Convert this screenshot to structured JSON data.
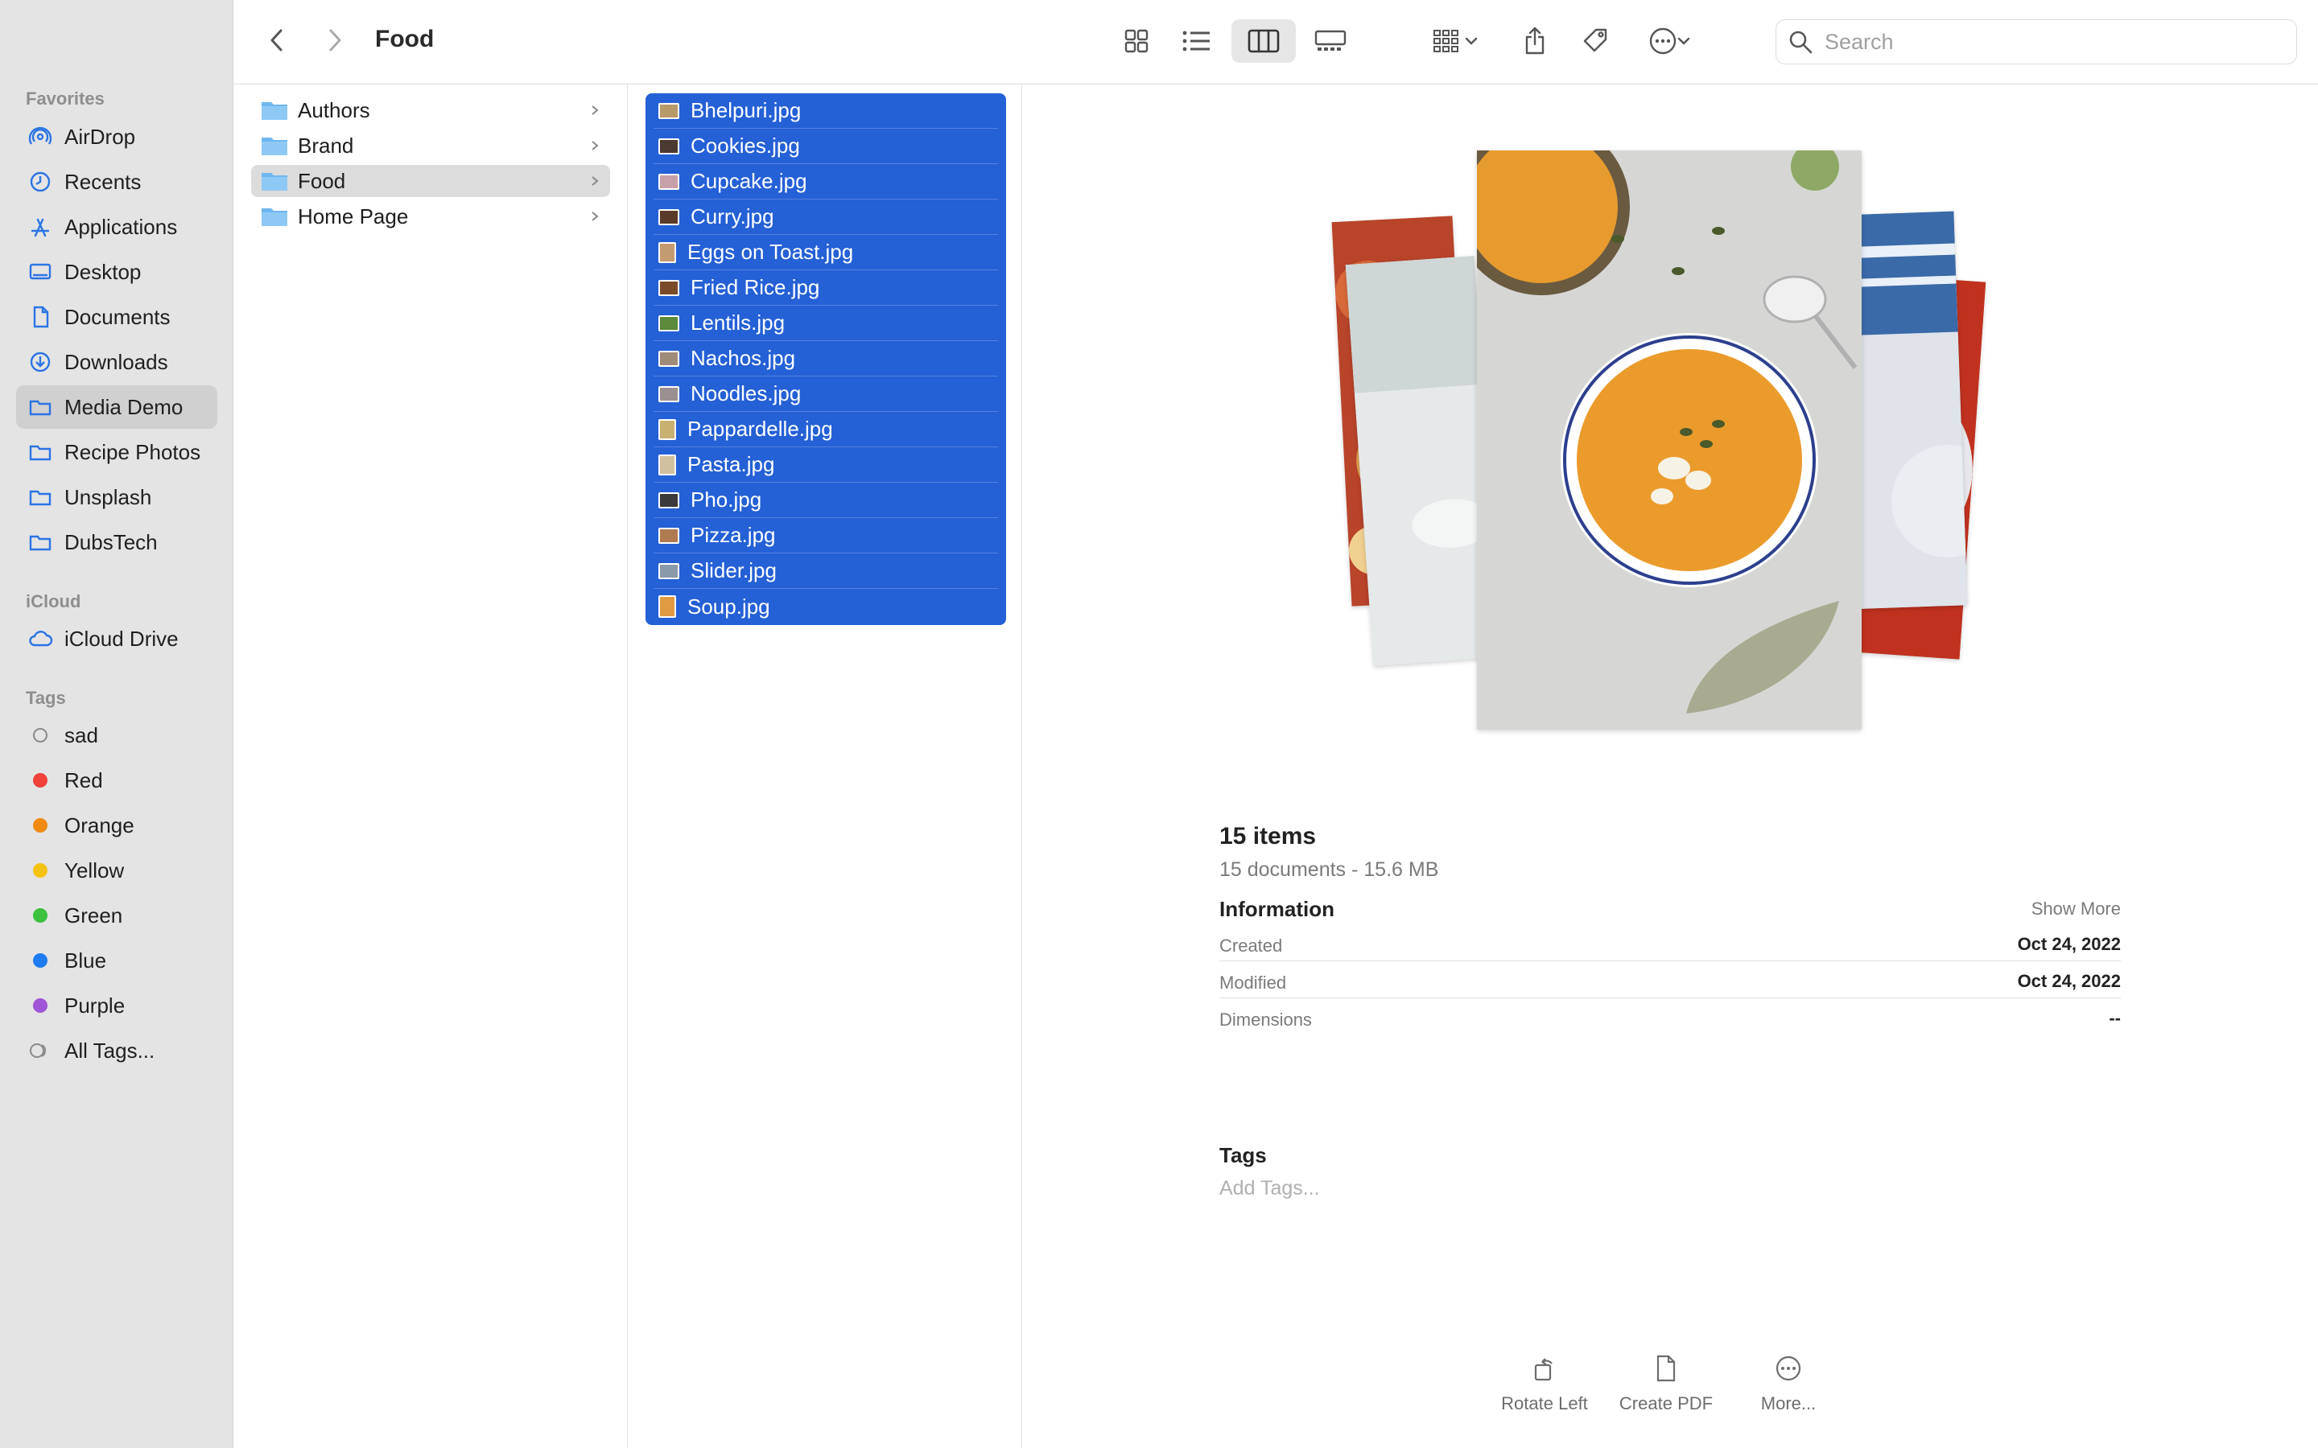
{
  "window": {
    "title": "Food"
  },
  "sidebar": {
    "favorites_title": "Favorites",
    "favorites": [
      {
        "label": "AirDrop",
        "icon": "airdrop-icon"
      },
      {
        "label": "Recents",
        "icon": "clock-icon"
      },
      {
        "label": "Applications",
        "icon": "applications-icon"
      },
      {
        "label": "Desktop",
        "icon": "desktop-icon"
      },
      {
        "label": "Documents",
        "icon": "document-icon"
      },
      {
        "label": "Downloads",
        "icon": "download-icon"
      },
      {
        "label": "Media Demo",
        "icon": "folder-icon",
        "selected": true
      },
      {
        "label": "Recipe Photos",
        "icon": "folder-icon"
      },
      {
        "label": "Unsplash",
        "icon": "folder-icon"
      },
      {
        "label": "DubsTech",
        "icon": "folder-icon"
      }
    ],
    "icloud_title": "iCloud",
    "icloud": [
      {
        "label": "iCloud Drive",
        "icon": "cloud-icon"
      }
    ],
    "tags_title": "Tags",
    "tags": [
      {
        "label": "sad",
        "color": "none"
      },
      {
        "label": "Red",
        "color": "#f0413a"
      },
      {
        "label": "Orange",
        "color": "#f08a12"
      },
      {
        "label": "Yellow",
        "color": "#f5c211"
      },
      {
        "label": "Green",
        "color": "#3cc23c"
      },
      {
        "label": "Blue",
        "color": "#1e7bf2"
      },
      {
        "label": "Purple",
        "color": "#a054d6"
      },
      {
        "label": "All Tags...",
        "color": "all"
      }
    ]
  },
  "toolbar": {
    "search_placeholder": "Search"
  },
  "column1": {
    "folders": [
      {
        "label": "Authors"
      },
      {
        "label": "Brand"
      },
      {
        "label": "Food",
        "selected": true
      },
      {
        "label": "Home Page"
      }
    ]
  },
  "column2": {
    "files": [
      {
        "label": "Bhelpuri.jpg"
      },
      {
        "label": "Cookies.jpg"
      },
      {
        "label": "Cupcake.jpg"
      },
      {
        "label": "Curry.jpg"
      },
      {
        "label": "Eggs on Toast.jpg"
      },
      {
        "label": "Fried Rice.jpg"
      },
      {
        "label": "Lentils.jpg"
      },
      {
        "label": "Nachos.jpg"
      },
      {
        "label": "Noodles.jpg"
      },
      {
        "label": "Pappardelle.jpg"
      },
      {
        "label": "Pasta.jpg"
      },
      {
        "label": "Pho.jpg"
      },
      {
        "label": "Pizza.jpg"
      },
      {
        "label": "Slider.jpg"
      },
      {
        "label": "Soup.jpg"
      }
    ]
  },
  "preview": {
    "count_title": "15 items",
    "summary": "15 documents - 15.6 MB",
    "information_title": "Information",
    "show_more": "Show More",
    "created_label": "Created",
    "created_value": "Oct 24, 2022",
    "modified_label": "Modified",
    "modified_value": "Oct 24, 2022",
    "dimensions_label": "Dimensions",
    "dimensions_value": "--",
    "tags_title": "Tags",
    "add_tags": "Add Tags...",
    "actions": {
      "rotate_left": "Rotate Left",
      "create_pdf": "Create PDF",
      "more": "More..."
    }
  }
}
